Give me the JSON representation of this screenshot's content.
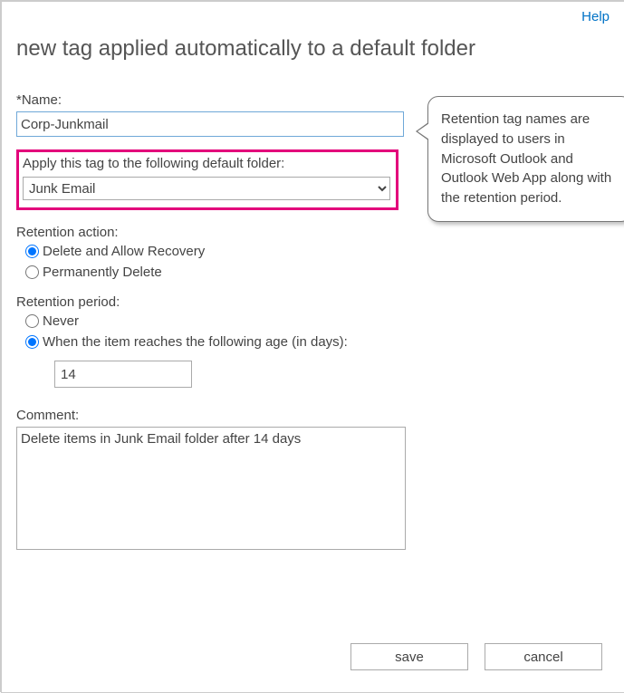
{
  "help": {
    "label": "Help"
  },
  "title": "new tag applied automatically to a default folder",
  "name": {
    "label": "*Name:",
    "value": "Corp-Junkmail"
  },
  "applyFolder": {
    "label": "Apply this tag to the following default folder:",
    "selected": "Junk Email"
  },
  "retentionAction": {
    "label": "Retention action:",
    "options": {
      "deleteAllow": "Delete and Allow Recovery",
      "permDelete": "Permanently Delete"
    },
    "selected": "deleteAllow"
  },
  "retentionPeriod": {
    "label": "Retention period:",
    "options": {
      "never": "Never",
      "whenAge": "When the item reaches the following age (in days):"
    },
    "selected": "whenAge",
    "days": "14"
  },
  "comment": {
    "label": "Comment:",
    "value": "Delete items in Junk Email folder after 14 days"
  },
  "callout": {
    "text": "Retention tag names are displayed to users in Microsoft Outlook and Outlook Web App along with the retention period."
  },
  "buttons": {
    "save": "save",
    "cancel": "cancel"
  }
}
